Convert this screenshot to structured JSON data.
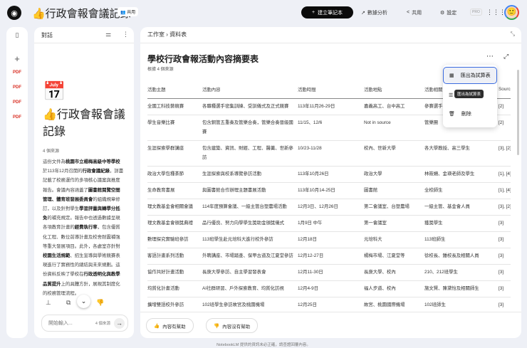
{
  "header": {
    "title": "👍行政會報會議記錄",
    "share_chip": "共用",
    "new_notebook": "建立筆記本",
    "analytics": "數據分析",
    "share": "共用",
    "settings": "設定",
    "pro_badge": "PRO"
  },
  "chat": {
    "title": "對話",
    "notebook_emoji": "📅",
    "notebook_title": "👍行政會報會議記錄",
    "source_count": "4 個來源",
    "summary": [
      {
        "t": "這份文件為",
        "b": false
      },
      {
        "t": "桃園市立楊梅高級中等學校",
        "b": true
      },
      {
        "t": "於113年12月召開的",
        "b": false
      },
      {
        "t": "行政會議紀錄",
        "b": true
      },
      {
        "t": "，詳盡記載了校務運作的多項核心議案與推度報告。會議內容涵蓋了",
        "b": false
      },
      {
        "t": "圖書館閱覽空間管理、體育班發展委員會",
        "b": true
      },
      {
        "t": "的組織規章修訂，以及針對學生",
        "b": false
      },
      {
        "t": "學習評量與轉學分抵免",
        "b": true
      },
      {
        "t": "的補充規定。報告中也透過數據呈現各項教育計畫的",
        "b": false
      },
      {
        "t": "經費執行率",
        "b": true
      },
      {
        "t": "，包含優質化工程、數位前導計畫及校舍耐震補強等重大發展項目。此外，各處室亦針對",
        "b": false
      },
      {
        "t": "校園生活規範",
        "b": true
      },
      {
        "t": "、招生宣導與學術競賽表現進行了實務性的總結與未來規劃。這份資料反映了學校在",
        "b": false
      },
      {
        "t": "行政透明化與教學品質提升",
        "b": true
      },
      {
        "t": "上的具體方針，展現其制度化的校務管理流程。",
        "b": false
      }
    ],
    "input_placeholder": "開始輸入...",
    "input_sources": "4 個來源"
  },
  "studio": {
    "breadcrumb_root": "工作室",
    "breadcrumb_sep": "›",
    "breadcrumb_current": "資料表",
    "table_title": "學校行政會報活動內容摘要表",
    "based_on": "根據 4 個來源",
    "columns": [
      "活動主題",
      "活動內容",
      "活動時間",
      "活動地點",
      "活動相關",
      "Source"
    ],
    "rows": [
      [
        "全國工科技藝競賽",
        "各職種選手密集訓練、受訓儀式及正式競賽",
        "113年11月26-29日",
        "嘉義高工、台中高工",
        "參賽選手",
        "[2]"
      ],
      [
        "學生音樂比賽",
        "包含銅管五重奏及管樂合奏，管樂合奏晉級國賽",
        "11/15、12/6",
        "Not in source",
        "管樂團",
        "[2]"
      ],
      [
        "生涯探索學群講座",
        "包含建築、資訊、財經、工程、醫藥、世新參訪",
        "10/23-11/28",
        "校內、世新大學",
        "各大學教授、高三學生",
        "[3], [2]"
      ],
      [
        "政治大學包種茶節",
        "生涯探索與校系導覽參訪活動",
        "113年10月26日",
        "政治大學",
        "林筱姍、金瑛老師及學生",
        "[1], [4]"
      ],
      [
        "生命教育書展",
        "與圖書館合作辦理主題書展活動",
        "113年10月14-25日",
        "圖書館",
        "全校師生",
        "[1], [4]"
      ],
      [
        "理文教基金會相關會議",
        "114年度預算會議、一級主管台塑農場活動",
        "12月3日、12月26日",
        "第二會議室、台塑農場",
        "一級主管、基金會人員",
        "[3], [2]"
      ],
      [
        "理文教基金會頒獎典禮",
        "品行優良、努力向學學生獎助金頒獎儀式",
        "1月9日 中午",
        "第一會議室",
        "獲獎學生",
        "[3]"
      ],
      [
        "數理探究實驗班參訪",
        "113班學生赴元培科大進行校外參訪",
        "12月18日",
        "元培科大",
        "113班師生",
        "[3]"
      ],
      [
        "客語計畫系列活動",
        "外聘講座、市場踏查、保甲古道及江夏堂參訪",
        "12月12-27日",
        "楊梅市場、江夏堂等",
        "徐校長、鍾校長及相關人員",
        "[3]"
      ],
      [
        "協作共好計畫活動",
        "長庚大學參訪、自主學習發表會",
        "12月11-30日",
        "長庚大學、校內",
        "210、212班學生",
        "[3]"
      ],
      [
        "均質化計畫活動",
        "AI社群研習、戶外探索教育、均質化訪視",
        "12月4-9日",
        "福人步道、校內",
        "施文賢、陳黛怡及相關師生",
        "[3]"
      ],
      [
        "擴增雙語校外參訪",
        "102班學生參訪故宮及桃園機場",
        "12月25日",
        "故宮、桃園國際機場",
        "102班師生",
        "[3]"
      ]
    ],
    "helpful": "內容有幫助",
    "not_helpful": "內容沒有幫助"
  },
  "menu": {
    "export": "匯出為試算表",
    "tooltip": "匯出為試算表",
    "delete": "刪除"
  },
  "footer": "NotebookLM 提供的資訊未必正確，請查證回覆內容。"
}
